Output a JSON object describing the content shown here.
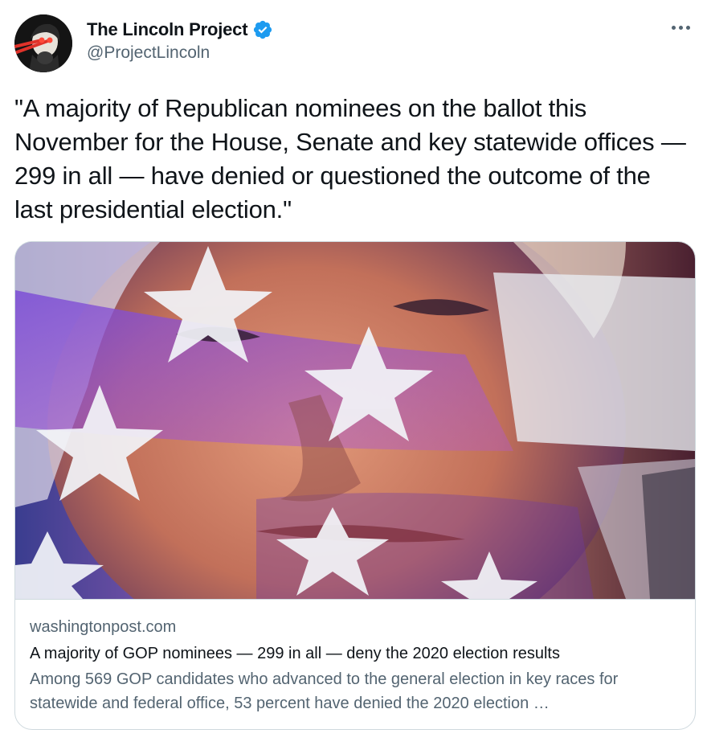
{
  "author": {
    "display_name": "The Lincoln Project",
    "handle": "@ProjectLincoln",
    "verified_icon": "verified-badge-icon",
    "verified_color": "#1d9bf0"
  },
  "tweet": {
    "text": "\"A majority of Republican nominees on the ballot this November for the House, Senate and key statewide offices — 299 in all — have denied or questioned the outcome of the last presidential election.\""
  },
  "card": {
    "domain": "washingtonpost.com",
    "title": "A majority of GOP nominees — 299 in all — deny the 2020 election results",
    "description": "Among 569 GOP candidates who advanced to the general election in key races for statewide and federal office, 53 percent have denied the 2020 election …"
  },
  "colors": {
    "text_primary": "#0f1419",
    "text_secondary": "#536471",
    "border": "#cfd9de"
  }
}
